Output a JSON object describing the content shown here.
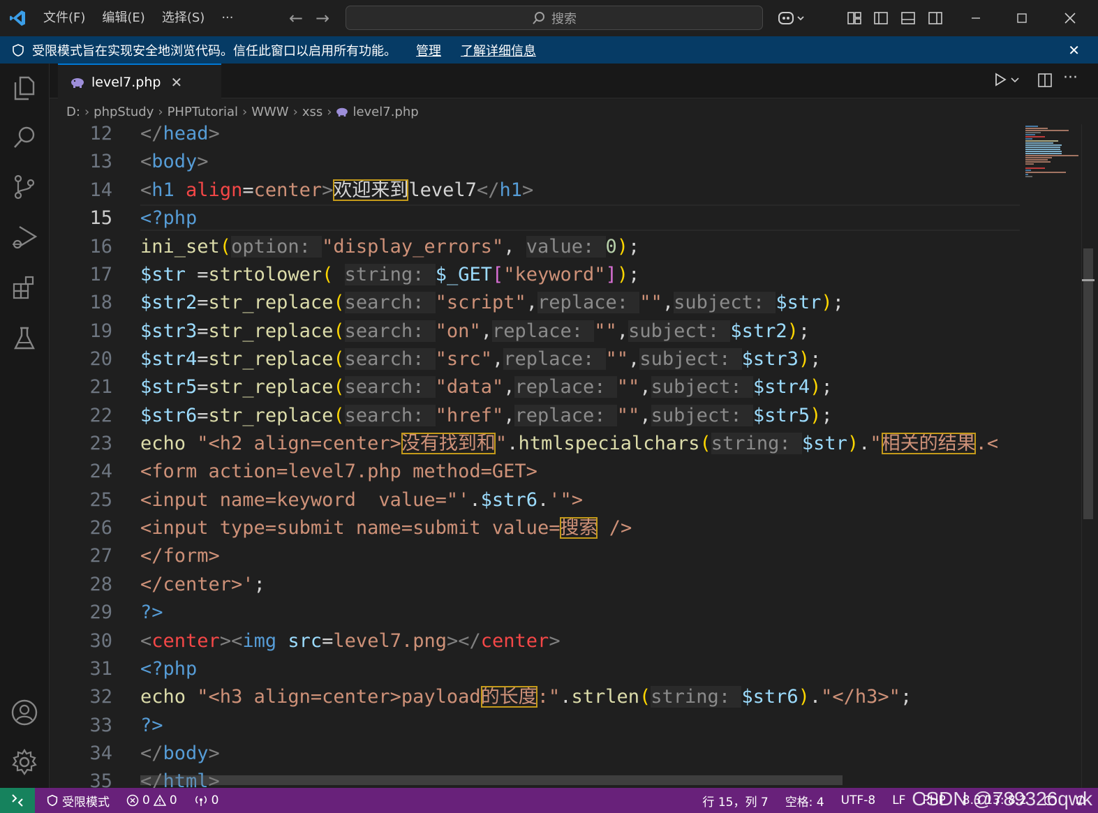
{
  "titlebar": {
    "menus": [
      "文件(F)",
      "编辑(E)",
      "选择(S)",
      "···"
    ],
    "search_placeholder": "搜索",
    "icons": [
      "vscode-logo-icon",
      "back-arrow-icon",
      "forward-arrow-icon",
      "copilot-icon",
      "layout-icon",
      "toggle-sidebar-icon",
      "toggle-panel-icon",
      "toggle-secondary-sidebar-icon",
      "minimize-icon",
      "maximize-icon",
      "close-icon"
    ]
  },
  "banner": {
    "message": "受限模式旨在实现安全地浏览代码。信任此窗口以启用所有功能。",
    "manage": "管理",
    "learn_more": "了解详细信息",
    "close": "✕"
  },
  "tab": {
    "label": "level7.php",
    "close": "✕"
  },
  "breadcrumb": [
    "D:",
    "phpStudy",
    "PHPTutorial",
    "WWW",
    "xss",
    "level7.php"
  ],
  "editor": {
    "line_numbers": [
      "12",
      "13",
      "14",
      "15",
      "16",
      "17",
      "18",
      "19",
      "20",
      "21",
      "22",
      "23",
      "24",
      "25",
      "26",
      "27",
      "28",
      "29",
      "30",
      "31",
      "32",
      "33",
      "34",
      "35"
    ],
    "active_line": "15"
  },
  "statusbar": {
    "restricted": "受限模式",
    "errors": "0",
    "warnings": "0",
    "ports": "0",
    "position": "行 15，列 7",
    "spaces": "空格: 4",
    "encoding": "UTF-8",
    "eol": "LF",
    "language": "PHP",
    "version": "8.3.13: 8.2"
  },
  "watermark": "CSDN @789326qwk",
  "colors": {
    "accent": "#0078d4",
    "status_bar": "#68217a",
    "banner": "#063b65",
    "remote": "#16825d"
  }
}
